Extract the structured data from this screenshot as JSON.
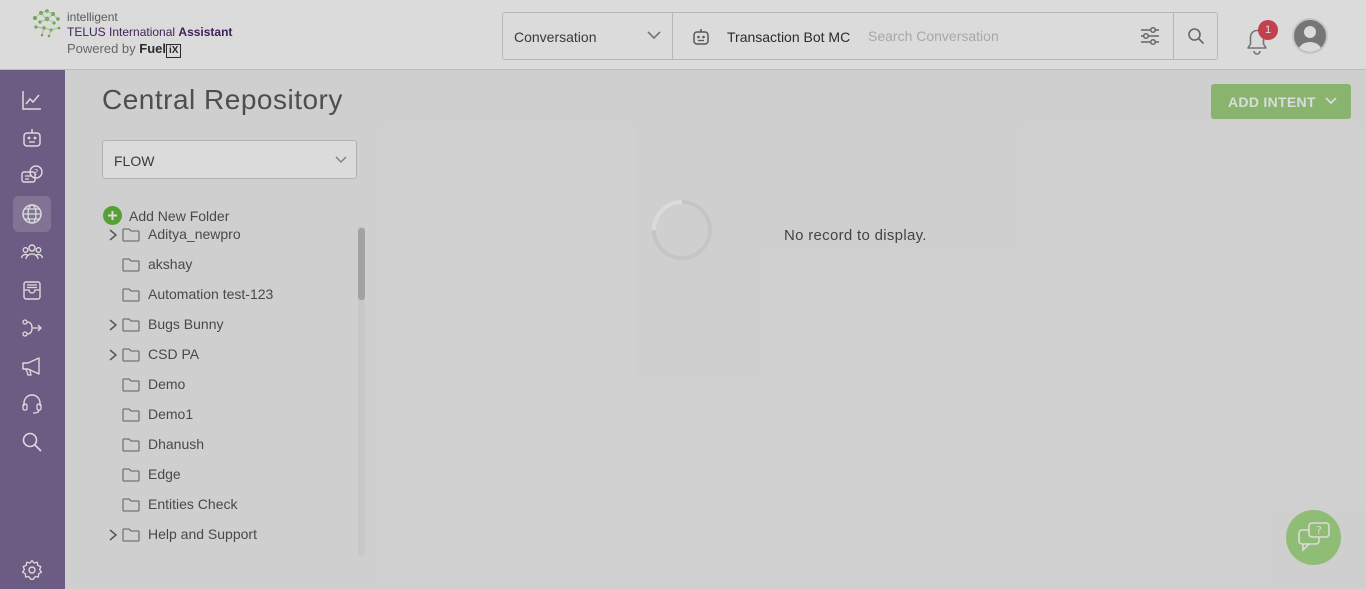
{
  "brand": {
    "line1": "intelligent",
    "line2_prefix": "TELUS International",
    "line2_bold": "Assistant",
    "line3_prefix": "Powered by",
    "line3_fuel": "Fuel",
    "line3_ix": "iX"
  },
  "header": {
    "search_scope": "Conversation",
    "bot_name": "Transaction Bot MC",
    "search_placeholder": "Search Conversation",
    "notification_count": "1"
  },
  "sidebar": {
    "items": [
      {
        "icon": "analytics-icon"
      },
      {
        "icon": "bot-icon"
      },
      {
        "icon": "faq-chat-icon"
      },
      {
        "icon": "globe-icon",
        "active": true
      },
      {
        "icon": "users-icon"
      },
      {
        "icon": "inbox-icon"
      },
      {
        "icon": "flow-icon"
      },
      {
        "icon": "megaphone-icon"
      },
      {
        "icon": "headset-icon"
      },
      {
        "icon": "search-icon"
      },
      {
        "icon": "settings-icon"
      }
    ]
  },
  "main": {
    "title": "Central Repository",
    "add_intent_label": "ADD INTENT",
    "type_filter": "FLOW",
    "add_folder_label": "Add New Folder",
    "empty_message": "No record to display."
  },
  "folders": [
    {
      "name": "Aditya_newpro",
      "expandable": true
    },
    {
      "name": "akshay",
      "expandable": false
    },
    {
      "name": "Automation test-123",
      "expandable": false
    },
    {
      "name": "Bugs Bunny",
      "expandable": true
    },
    {
      "name": "CSD PA",
      "expandable": true
    },
    {
      "name": "Demo",
      "expandable": false
    },
    {
      "name": "Demo1",
      "expandable": false
    },
    {
      "name": "Dhanush",
      "expandable": false
    },
    {
      "name": "Edge",
      "expandable": false
    },
    {
      "name": "Entities Check",
      "expandable": false
    },
    {
      "name": "Help and Support",
      "expandable": true
    }
  ],
  "colors": {
    "sidebar": "#7e6c9a",
    "accent_green": "#9fd27f",
    "brand_purple": "#4b286d",
    "badge_red": "#e34b5a"
  }
}
